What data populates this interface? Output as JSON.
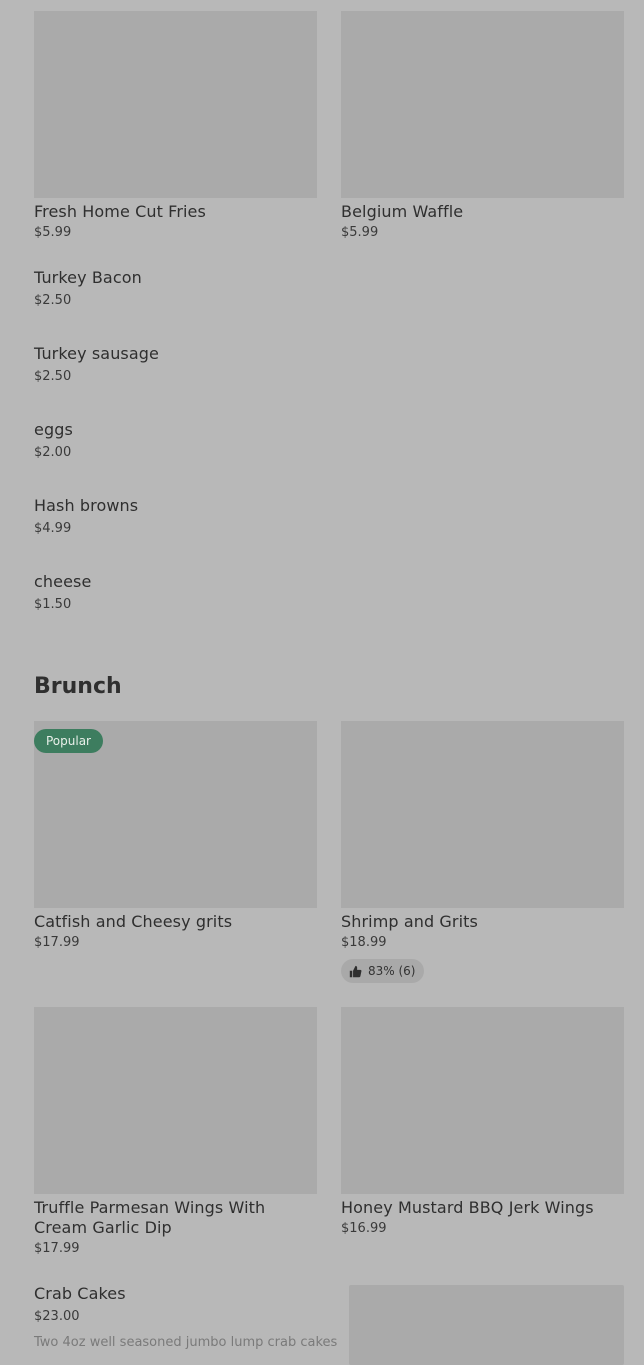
{
  "top_cards": [
    {
      "name": "Fresh Home Cut Fries",
      "price": "$5.99"
    },
    {
      "name": "Belgium Waffle",
      "price": "$5.99"
    }
  ],
  "simple_items": [
    {
      "name": "Turkey Bacon",
      "price": "$2.50"
    },
    {
      "name": "Turkey sausage",
      "price": "$2.50"
    },
    {
      "name": "eggs",
      "price": "$2.00"
    },
    {
      "name": "Hash browns",
      "price": "$4.99"
    },
    {
      "name": "cheese",
      "price": "$1.50"
    }
  ],
  "brunch": {
    "title": "Brunch",
    "cards": [
      {
        "name": "Catfish and Cheesy grits",
        "price": "$17.99",
        "badge": "Popular"
      },
      {
        "name": "Shrimp and Grits",
        "price": "$18.99",
        "rating": "83% (6)"
      },
      {
        "name": "Truffle Parmesan Wings With Cream Garlic Dip",
        "price": "$17.99"
      },
      {
        "name": "Honey Mustard BBQ Jerk Wings",
        "price": "$16.99"
      }
    ],
    "list_item": {
      "name": "Crab Cakes",
      "price": "$23.00",
      "description": "Two 4oz well seasoned jumbo lump crab cakes"
    }
  },
  "icons": {
    "rating": "thumbs-up-icon"
  },
  "colors": {
    "background": "#b8b8b8",
    "image_placeholder": "#aaaaaa",
    "popular_badge": "#3d7d5f"
  }
}
